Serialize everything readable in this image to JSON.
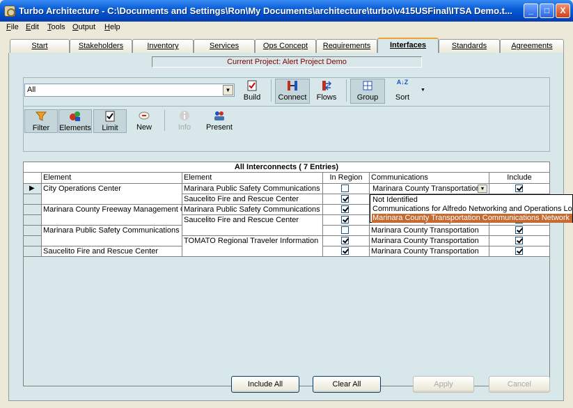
{
  "window": {
    "title": "Turbo Architecture - C:\\Documents and Settings\\Ron\\My Documents\\architecture\\turbo\\v415USFinal\\ITSA Demo.t...",
    "controls": [
      "_",
      "□",
      "X"
    ]
  },
  "menu": [
    "File",
    "Edit",
    "Tools",
    "Output",
    "Help"
  ],
  "tabs": [
    "Start",
    "Stakeholders",
    "Inventory",
    "Services",
    "Ops Concept",
    "Requirements",
    "Interfaces",
    "Standards",
    "Agreements"
  ],
  "active_tab": "Interfaces",
  "current_project": "Current Project: Alert Project Demo",
  "filter_combo": {
    "value": "All",
    "arrow": "▼"
  },
  "toolbar1": [
    {
      "label": "Build",
      "icon": "build-icon"
    },
    {
      "label": "Connect",
      "icon": "connect-icon",
      "pressed": true
    },
    {
      "label": "Flows",
      "icon": "flows-icon"
    },
    {
      "label": "Group",
      "icon": "group-icon",
      "pressed": true
    },
    {
      "label": "Sort",
      "icon": "sort-icon"
    }
  ],
  "sort_icon_text": "A↓Z",
  "toolbar2": [
    {
      "label": "Filter",
      "icon": "filter-icon",
      "pressed": true
    },
    {
      "label": "Elements",
      "icon": "elements-icon",
      "pressed": true
    },
    {
      "label": "Limit",
      "icon": "limit-icon",
      "pressed": true
    },
    {
      "label": "New",
      "icon": "new-icon"
    },
    {
      "label": "Info",
      "icon": "info-icon",
      "disabled": true
    },
    {
      "label": "Present",
      "icon": "present-icon"
    }
  ],
  "grid": {
    "title": "All Interconnects  ( 7 Entries)",
    "headers": [
      "Element",
      "Element",
      "In Region",
      "Communications",
      "Include"
    ],
    "rows": [
      {
        "el1": "City Operations Center",
        "el2": "Marinara Public Safety Communications and",
        "in_region": false,
        "comm": "Marinara County Transportation",
        "include": true,
        "current": true
      },
      {
        "el1": "",
        "el2": "Saucelito Fire and Rescue Center",
        "in_region": true,
        "comm": "",
        "include": false
      },
      {
        "el1": "Marinara County Freeway Management Cent",
        "el2": "Marinara Public Safety Communications and",
        "in_region": true,
        "comm": "",
        "include": false
      },
      {
        "el1": "",
        "el2": "Saucelito Fire and Rescue Center",
        "in_region": true,
        "comm": "Marinara County Transportation",
        "include": true
      },
      {
        "el1": "Marinara Public Safety Communications and",
        "el2": "",
        "in_region": false,
        "comm": "Marinara County Transportation",
        "include": true
      },
      {
        "el1": "",
        "el2": "TOMATO Regional Traveler Information",
        "in_region": true,
        "comm": "Marinara County Transportation",
        "include": true
      },
      {
        "el1": "Saucelito Fire and Rescue Center",
        "el2": "",
        "in_region": true,
        "comm": "Marinara County Transportation",
        "include": true
      }
    ],
    "dropdown_options": [
      "Not Identified",
      "Communications for Alfredo Networking and Operations Local",
      "Marinara County Transportation Communications Network"
    ],
    "dropdown_selected": 2,
    "row_indicator": "▶"
  },
  "buttons": {
    "include_all": "Include All",
    "clear_all": "Clear All",
    "apply": "Apply",
    "cancel": "Cancel"
  },
  "colors": {
    "panel": "#d8e8ea",
    "title_bar": "#0a5fd8",
    "project_text": "#800000",
    "selection": "#c56a31"
  }
}
